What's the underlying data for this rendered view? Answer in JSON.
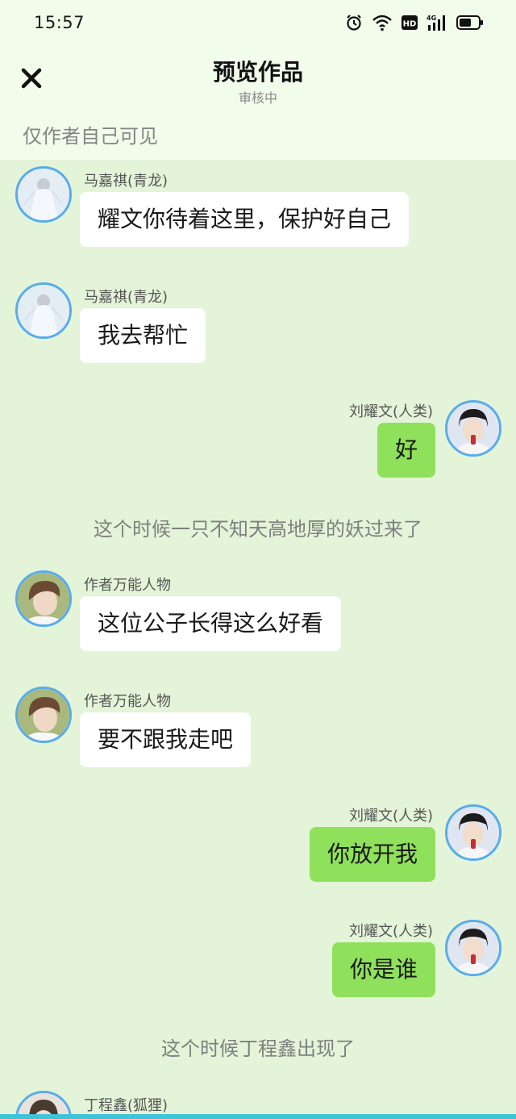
{
  "status_bar": {
    "time": "15:57",
    "icons": [
      "alarm-icon",
      "wifi-icon",
      "hd-icon",
      "signal-4g-icon",
      "battery-icon"
    ],
    "hd_label": "HD",
    "network_label": "4G"
  },
  "header": {
    "close_icon": "close-icon",
    "title": "预览作品",
    "subtitle": "审核中"
  },
  "visibility_note": "仅作者自己可见",
  "messages": [
    {
      "side": "left",
      "name": "马嘉祺(青龙)",
      "text": "耀文你待着这里，保护好自己"
    },
    {
      "side": "left",
      "name": "马嘉祺(青龙)",
      "text": "我去帮忙"
    },
    {
      "side": "right",
      "name": "刘耀文(人类)",
      "text": "好"
    },
    {
      "side": "narration",
      "text": "这个时候一只不知天高地厚的妖过来了"
    },
    {
      "side": "left",
      "name": "作者万能人物",
      "text": "这位公子长得这么好看"
    },
    {
      "side": "left",
      "name": "作者万能人物",
      "text": "要不跟我走吧"
    },
    {
      "side": "right",
      "name": "刘耀文(人类)",
      "text": "你放开我"
    },
    {
      "side": "right",
      "name": "刘耀文(人类)",
      "text": "你是谁"
    },
    {
      "side": "narration",
      "text": "这个时候丁程鑫出现了"
    },
    {
      "side": "left",
      "name": "丁程鑫(狐狸)",
      "text": ""
    }
  ],
  "colors": {
    "background": "#e3f4d8",
    "header_background": "#f1fcea",
    "left_bubble": "#ffffff",
    "right_bubble": "#8fe05a",
    "avatar_border": "#58acea"
  }
}
